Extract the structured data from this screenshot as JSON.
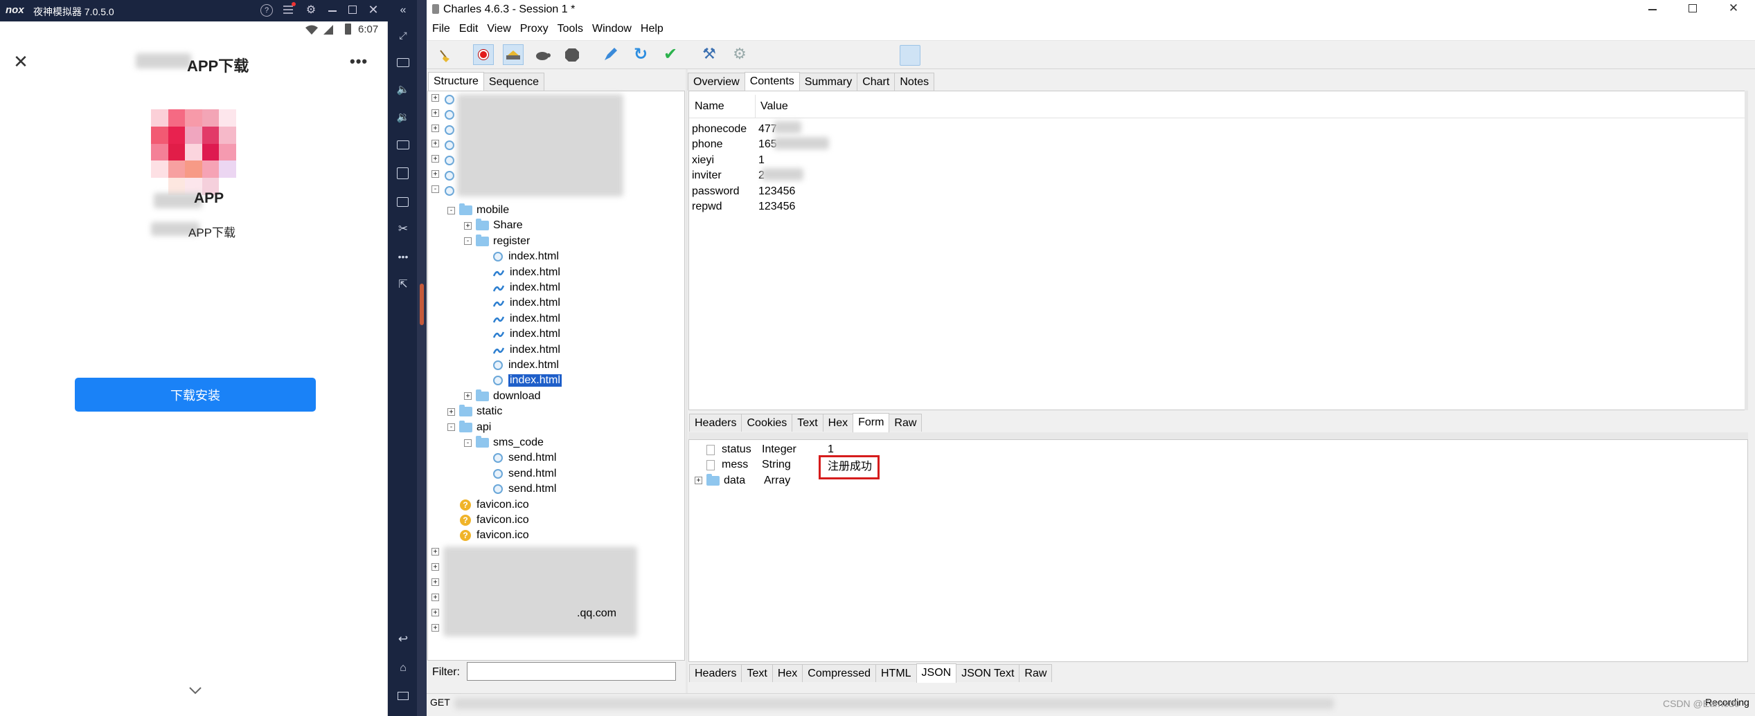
{
  "emulator": {
    "logo": "nox",
    "title": "夜神模拟器 7.0.5.0",
    "status_time": "6:07",
    "app_header_title": "APP下载",
    "app_name": "APP",
    "app_subtitle": "APP下载",
    "download_button": "下载安装",
    "icons": [
      "help-icon",
      "menu-icon",
      "settings-icon",
      "minimize-icon",
      "maximize-icon",
      "close-icon",
      "collapse-icon",
      "wifi-icon",
      "signal-icon",
      "battery-icon",
      "close-x-icon",
      "more-icon",
      "chevron-down-icon"
    ],
    "sidebar_icons": [
      "expand-icon",
      "keyboard-icon",
      "volume-up-icon",
      "volume-down-icon",
      "screen-icon",
      "install-icon",
      "toolbox-icon",
      "scissors-icon",
      "more-icon",
      "open-icon",
      "back-icon",
      "home-icon",
      "recents-icon"
    ]
  },
  "charles": {
    "title": "Charles 4.6.3 - Session 1 *",
    "menu": [
      "File",
      "Edit",
      "View",
      "Proxy",
      "Tools",
      "Window",
      "Help"
    ],
    "toolbar": [
      "broom-icon",
      "record-icon",
      "throttle-icon",
      "turtle-icon",
      "stop-icon",
      "pen-icon",
      "refresh-icon",
      "check-icon",
      "tools-icon",
      "settings-icon"
    ],
    "left_tabs": [
      "Structure",
      "Sequence"
    ],
    "tree": [
      {
        "label": "mobile",
        "type": "folder",
        "depth": 1,
        "expand": "-"
      },
      {
        "label": "Share",
        "type": "folder",
        "depth": 2,
        "expand": "+"
      },
      {
        "label": "register",
        "type": "folder",
        "depth": 2,
        "expand": "-"
      },
      {
        "label": "index.html",
        "type": "globe",
        "depth": 3
      },
      {
        "label": "index.html",
        "type": "wave",
        "depth": 3
      },
      {
        "label": "index.html",
        "type": "wave",
        "depth": 3
      },
      {
        "label": "index.html",
        "type": "wave",
        "depth": 3
      },
      {
        "label": "index.html",
        "type": "wave",
        "depth": 3
      },
      {
        "label": "index.html",
        "type": "wave",
        "depth": 3
      },
      {
        "label": "index.html",
        "type": "wave",
        "depth": 3
      },
      {
        "label": "index.html",
        "type": "globe",
        "depth": 3
      },
      {
        "label": "index.html",
        "type": "globe",
        "depth": 3,
        "selected": true
      },
      {
        "label": "download",
        "type": "folder",
        "depth": 2,
        "expand": "+"
      },
      {
        "label": "static",
        "type": "folder",
        "depth": 1,
        "expand": "+"
      },
      {
        "label": "api",
        "type": "folder",
        "depth": 1,
        "expand": "-"
      },
      {
        "label": "sms_code",
        "type": "folder",
        "depth": 2,
        "expand": "-"
      },
      {
        "label": "send.html",
        "type": "globe",
        "depth": 3
      },
      {
        "label": "send.html",
        "type": "globe",
        "depth": 3
      },
      {
        "label": "send.html",
        "type": "globe",
        "depth": 3
      },
      {
        "label": "favicon.ico",
        "type": "q",
        "depth": 1
      },
      {
        "label": "favicon.ico",
        "type": "q",
        "depth": 1
      },
      {
        "label": "favicon.ico",
        "type": "q",
        "depth": 1
      }
    ],
    "tree_partial_host": ".qq.com",
    "filter_label": "Filter:",
    "filter_value": "",
    "right_tabs": [
      "Overview",
      "Contents",
      "Summary",
      "Chart",
      "Notes"
    ],
    "request_columns": [
      "Name",
      "Value"
    ],
    "request_rows": [
      {
        "name": "phonecode",
        "value": "477"
      },
      {
        "name": "phone",
        "value": "165"
      },
      {
        "name": "xieyi",
        "value": "1"
      },
      {
        "name": "inviter",
        "value": "2"
      },
      {
        "name": "password",
        "value": "123456"
      },
      {
        "name": "repwd",
        "value": "123456"
      }
    ],
    "request_tabs": [
      "Headers",
      "Cookies",
      "Text",
      "Hex",
      "Form",
      "Raw"
    ],
    "response_rows": [
      {
        "name": "status",
        "type": "Integer",
        "value": "1"
      },
      {
        "name": "mess",
        "type": "String",
        "value": "注册成功"
      },
      {
        "name": "data",
        "type": "Array",
        "value": ""
      }
    ],
    "response_tabs": [
      "Headers",
      "Text",
      "Hex",
      "Compressed",
      "HTML",
      "JSON",
      "JSON Text",
      "Raw"
    ],
    "status_method": "GET",
    "status_right": "Recording",
    "watermark": "CSDN @Earned0"
  }
}
